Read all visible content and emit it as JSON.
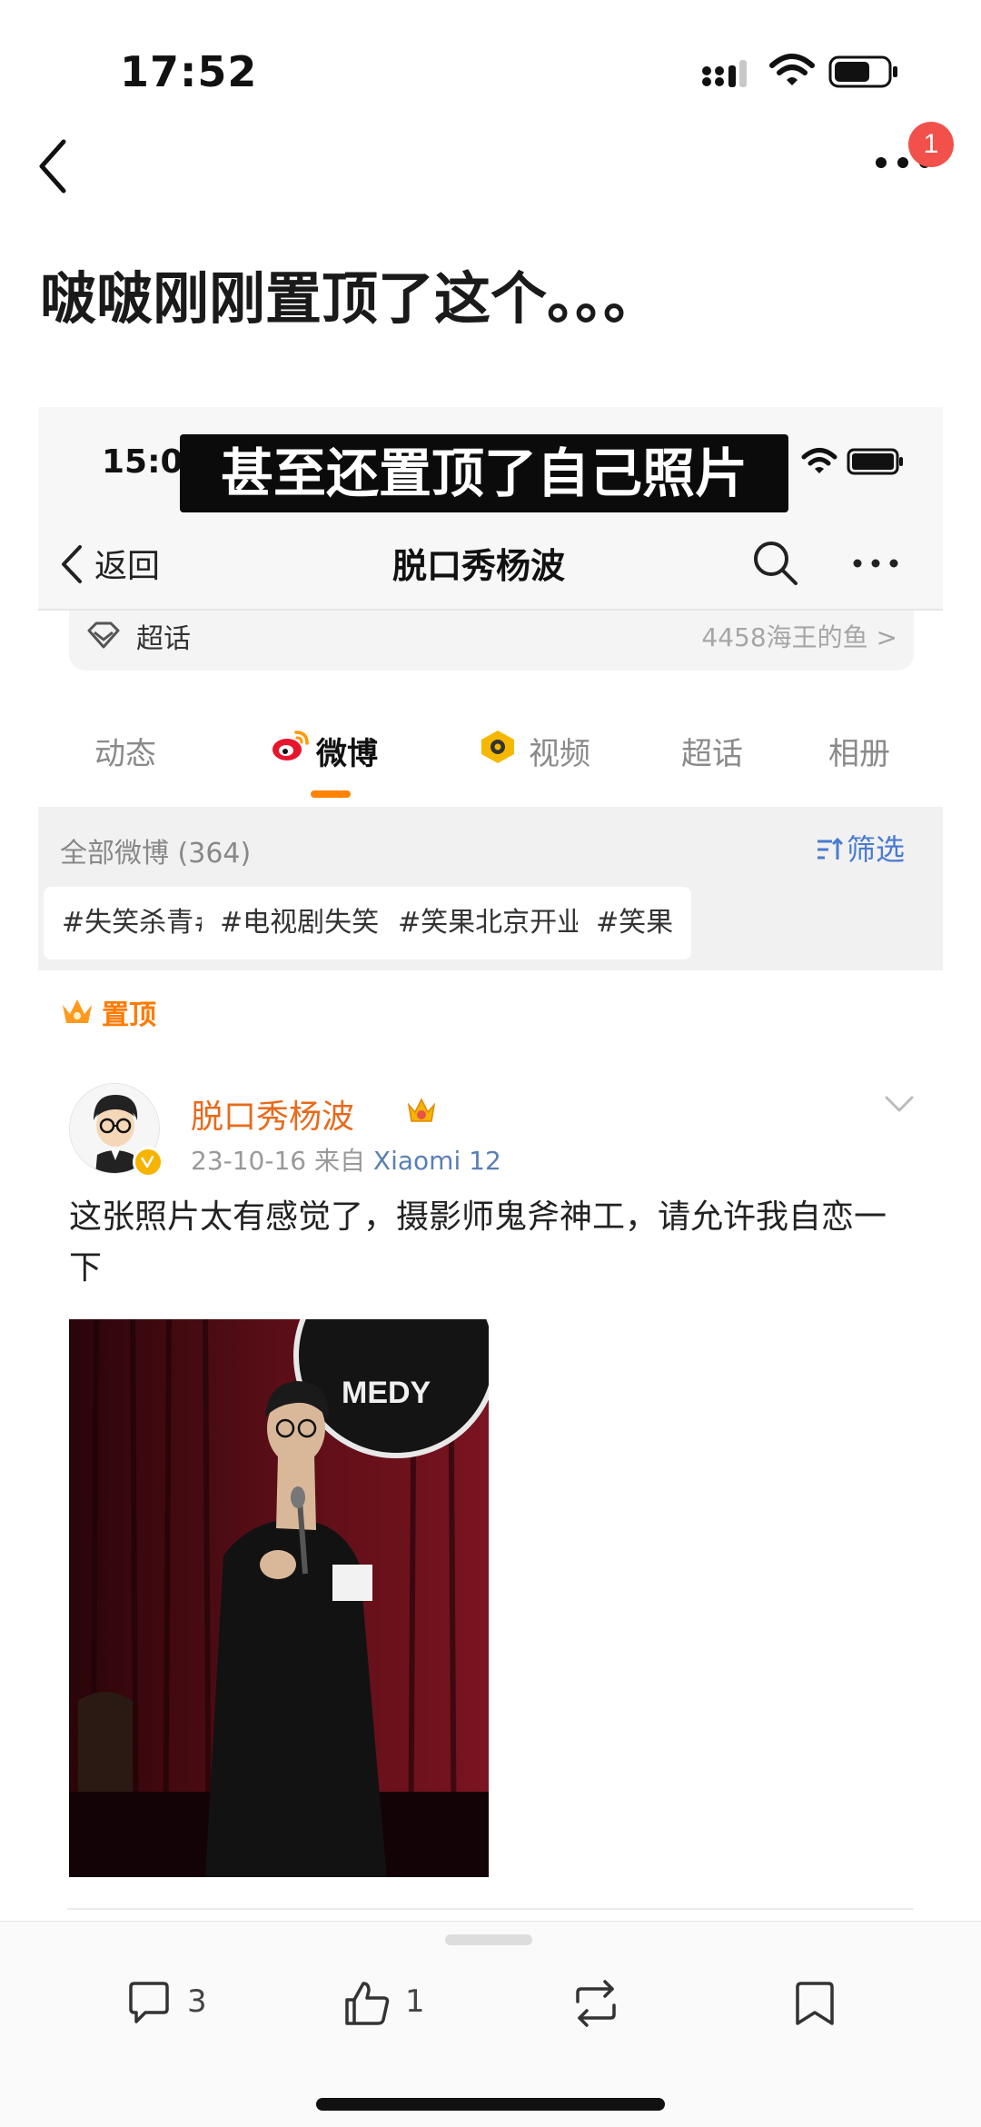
{
  "status_bar": {
    "time": "17:52"
  },
  "nav": {
    "notification_badge": "1"
  },
  "post_title": "啵啵刚刚置顶了这个。。。",
  "embedded": {
    "status_time": "15:0",
    "caption": "甚至还置顶了自己照片",
    "nav_back_label": "返回",
    "nav_title": "脱口秀杨波",
    "supertopic": {
      "label": "超话",
      "right_text": "4458海王的鱼 >"
    },
    "tabs": [
      {
        "label": "动态"
      },
      {
        "label": "微博"
      },
      {
        "label": "视频"
      },
      {
        "label": "超话"
      },
      {
        "label": "相册"
      }
    ],
    "all_weibo": "全部微博 (364)",
    "filter_label": "筛选",
    "chips": [
      "#失笑杀青#",
      "#电视剧失笑#",
      "#笑果北京开业#",
      "#笑果"
    ],
    "chip_arrow": "▸",
    "pinned_label": "置顶",
    "post": {
      "author": "脱口秀杨波",
      "date": "23-10-16",
      "from_label": "来自",
      "device": "Xiaomi 12",
      "text": "这张照片太有感觉了，摄影师鬼斧神工，请允许我自恋一下",
      "photo_sign_text": "MEDY"
    },
    "colors": {
      "accent": "#ff8200",
      "link": "#4a7bd0",
      "author": "#e86a1a"
    }
  },
  "actions": {
    "comment_count": "3",
    "like_count": "1"
  }
}
